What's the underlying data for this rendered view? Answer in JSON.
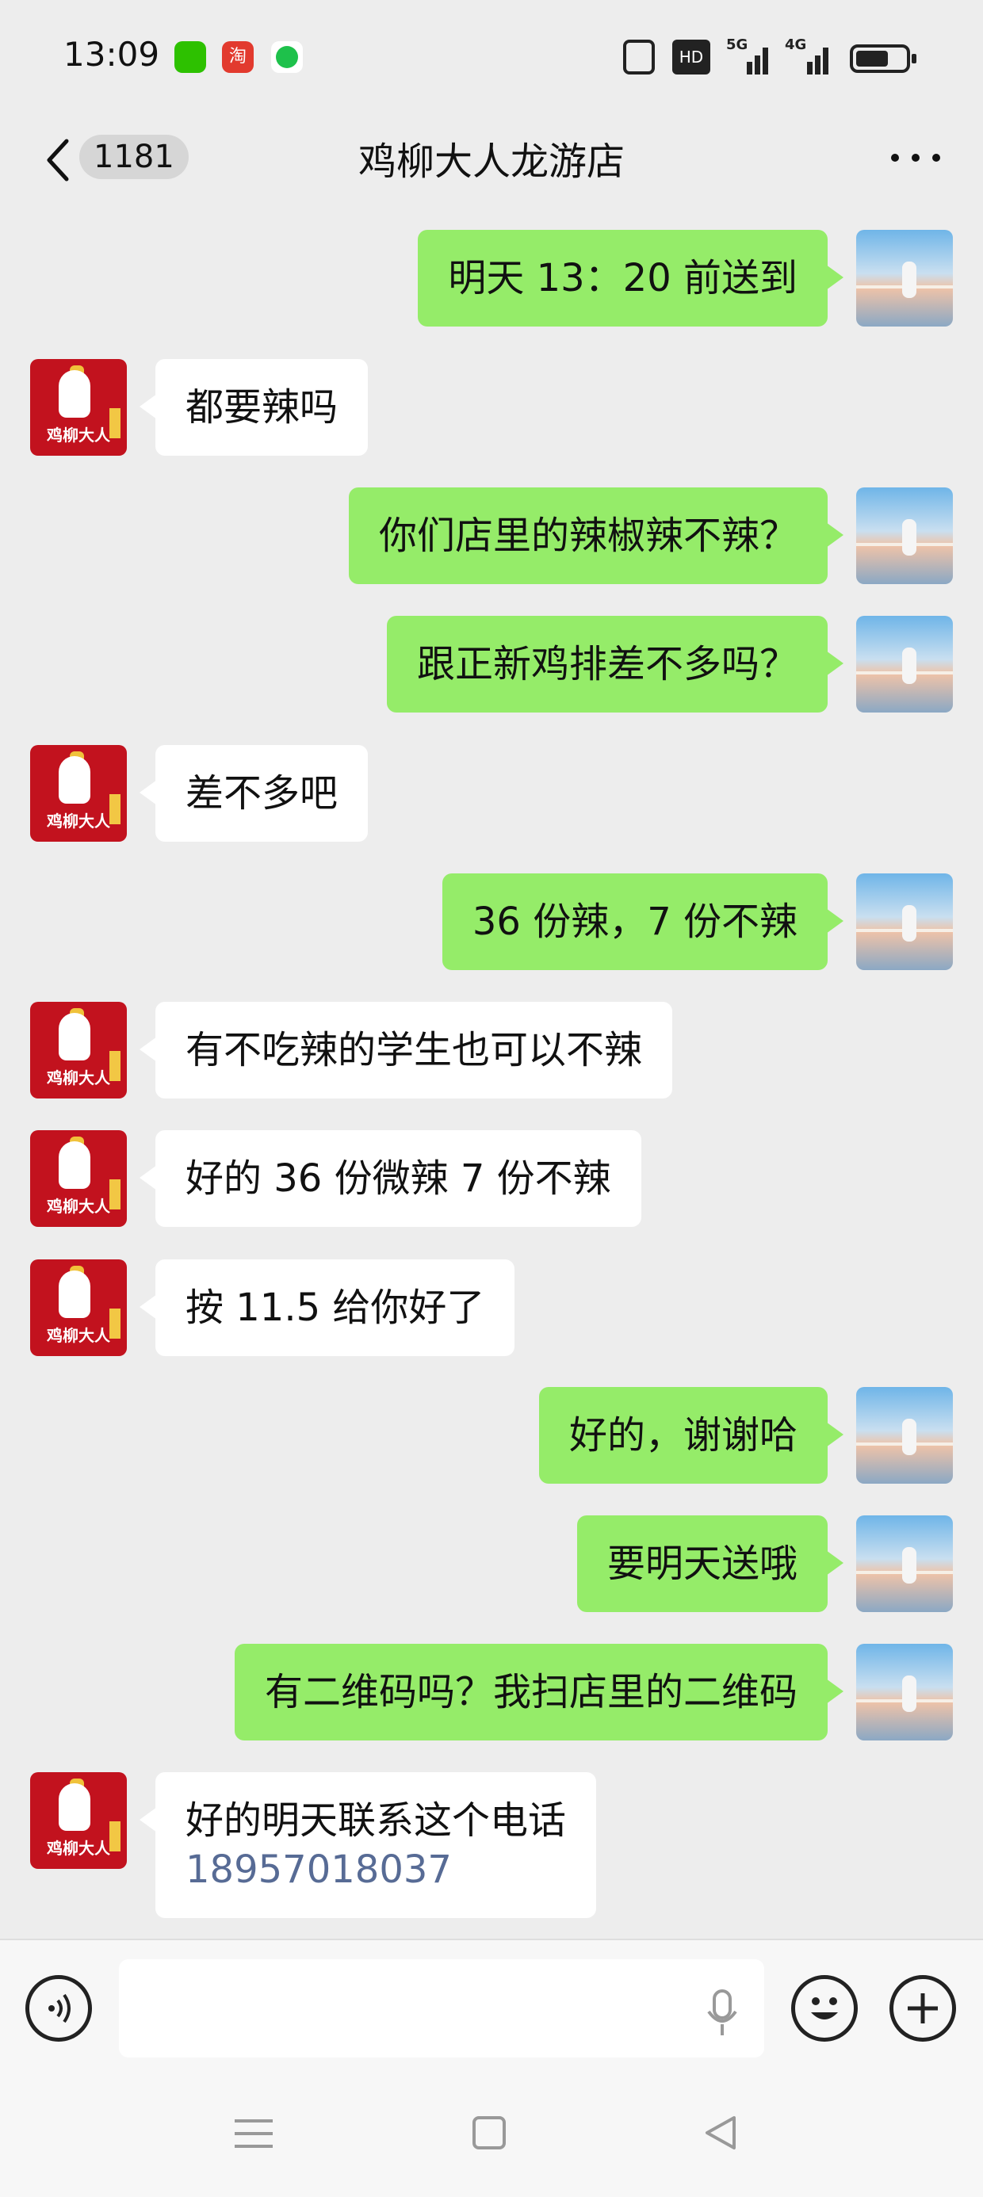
{
  "status_bar": {
    "time": "13:09",
    "apps": [
      "wechat-app-icon",
      "taobao-app-icon",
      "message-app-icon"
    ],
    "taobao_label": "淘",
    "hd_label": "HD",
    "network_1": "5G",
    "network_2": "4G"
  },
  "header": {
    "unread_count": "1181",
    "title": "鸡柳大人龙游店"
  },
  "contact": {
    "brand_text": "鸡柳大人"
  },
  "messages": [
    {
      "from": "me",
      "text": "明天 13：20 前送到"
    },
    {
      "from": "them",
      "text": "都要辣吗"
    },
    {
      "from": "me",
      "text": "你们店里的辣椒辣不辣？"
    },
    {
      "from": "me",
      "text": "跟正新鸡排差不多吗？"
    },
    {
      "from": "them",
      "text": "差不多吧"
    },
    {
      "from": "me",
      "text": "36 份辣，7 份不辣"
    },
    {
      "from": "them",
      "text": "有不吃辣的学生也可以不辣"
    },
    {
      "from": "them",
      "text": "好的 36 份微辣 7 份不辣"
    },
    {
      "from": "them",
      "text": "按 11.5 给你好了"
    },
    {
      "from": "me",
      "text": "好的，谢谢哈"
    },
    {
      "from": "me",
      "text": "要明天送哦"
    },
    {
      "from": "me",
      "text": "有二维码吗？我扫店里的二维码"
    },
    {
      "from": "them",
      "text": "好的明天联系这个电话",
      "phone": "18957018037"
    }
  ],
  "input": {
    "value": "",
    "placeholder": ""
  },
  "colors": {
    "my_bubble": "#95ec69",
    "their_bubble": "#ffffff",
    "background": "#ededed",
    "link": "#576b95",
    "brand_red": "#c2121e"
  }
}
